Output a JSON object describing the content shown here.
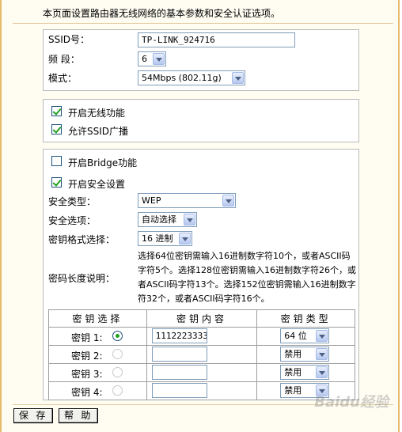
{
  "description": "本页面设置路由器无线网络的基本参数和安全认证选项。",
  "basic": {
    "ssid_label": "SSID号：",
    "ssid_value": "TP-LINK_924716",
    "channel_label": "频 段：",
    "channel_value": "6",
    "mode_label": "模式：",
    "mode_value": "54Mbps (802.11g)"
  },
  "wireless": {
    "enable_label": "开启无线功能",
    "enable_checked": true,
    "broadcast_label": "允许SSID广播",
    "broadcast_checked": true
  },
  "security": {
    "bridge_label": "开启Bridge功能",
    "bridge_checked": false,
    "security_label": "开启安全设置",
    "security_checked": true,
    "type_label": "安全类型：",
    "type_value": "WEP",
    "option_label": "安全选项：",
    "option_value": "自动选择",
    "format_label": "密钥格式选择：",
    "format_value": "16 进制",
    "length_label": "密码长度说明：",
    "length_help": "选择64位密钥需输入16进制数字符10个，或者ASCII码字符5个。选择128位密钥需输入16进制数字符26个，或者ASCII码字符13个。选择152位密钥需输入16进制数字符32个，或者ASCII码字符16个。"
  },
  "keys_table": {
    "headers": [
      "密钥选择",
      "密钥内容",
      "密钥类型"
    ],
    "rows": [
      {
        "label": "密钥 1:",
        "selected": true,
        "content": "1112223333",
        "type": "64 位"
      },
      {
        "label": "密钥 2:",
        "selected": false,
        "content": "",
        "type": "禁用"
      },
      {
        "label": "密钥 3:",
        "selected": false,
        "content": "",
        "type": "禁用"
      },
      {
        "label": "密钥 4:",
        "selected": false,
        "content": "",
        "type": "禁用"
      }
    ]
  },
  "buttons": {
    "save": "保 存",
    "help": "帮 助"
  },
  "watermark": "Baidu经验"
}
